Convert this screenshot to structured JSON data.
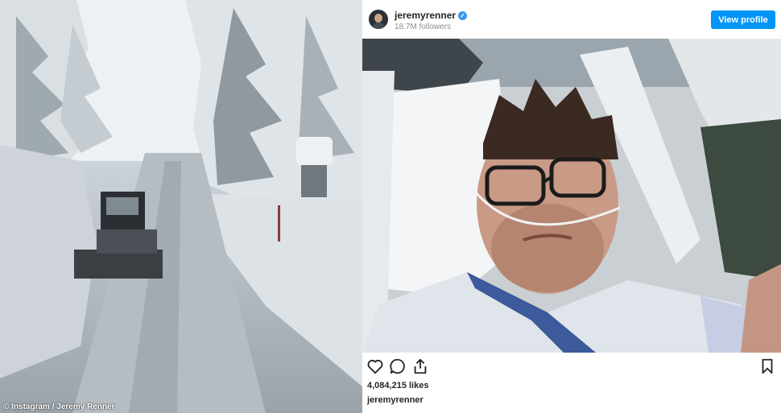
{
  "left_photo": {
    "credit": "© Instagram / Jeremy Renner"
  },
  "post": {
    "username": "jeremyrenner",
    "followers": "18.7M followers",
    "view_profile_label": "View profile",
    "likes": "4,084,215 likes",
    "caption_username": "jeremyrenner",
    "icons": [
      "heart-icon",
      "comment-icon",
      "share-icon",
      "bookmark-icon"
    ]
  }
}
